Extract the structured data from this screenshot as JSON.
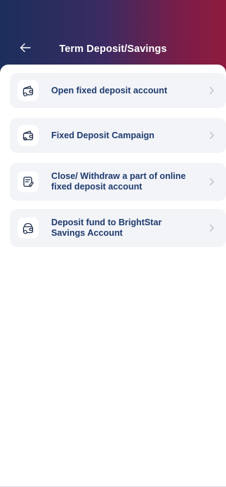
{
  "header": {
    "title": "Term Deposit/Savings",
    "back_icon": "arrow-left-icon"
  },
  "menu": {
    "items": [
      {
        "label": "Open fixed deposit account",
        "icon": "wallet-coins-icon"
      },
      {
        "label": "Fixed Deposit Campaign",
        "icon": "wallet-sparkle-icon"
      },
      {
        "label": "Close/ Withdraw a part of online fixed deposit account",
        "icon": "document-edit-icon"
      },
      {
        "label": "Deposit fund to BrightStar Savings Account",
        "icon": "piggy-wallet-icon"
      }
    ],
    "chevron_icon": "chevron-right-icon"
  },
  "colors": {
    "header_gradient_start": "#1b2f5c",
    "header_gradient_end": "#8f1b3e",
    "item_background": "#f2f4f8",
    "item_text": "#1f3b6e",
    "icon_stroke": "#1f2d4a",
    "chevron": "#b9bec7"
  }
}
